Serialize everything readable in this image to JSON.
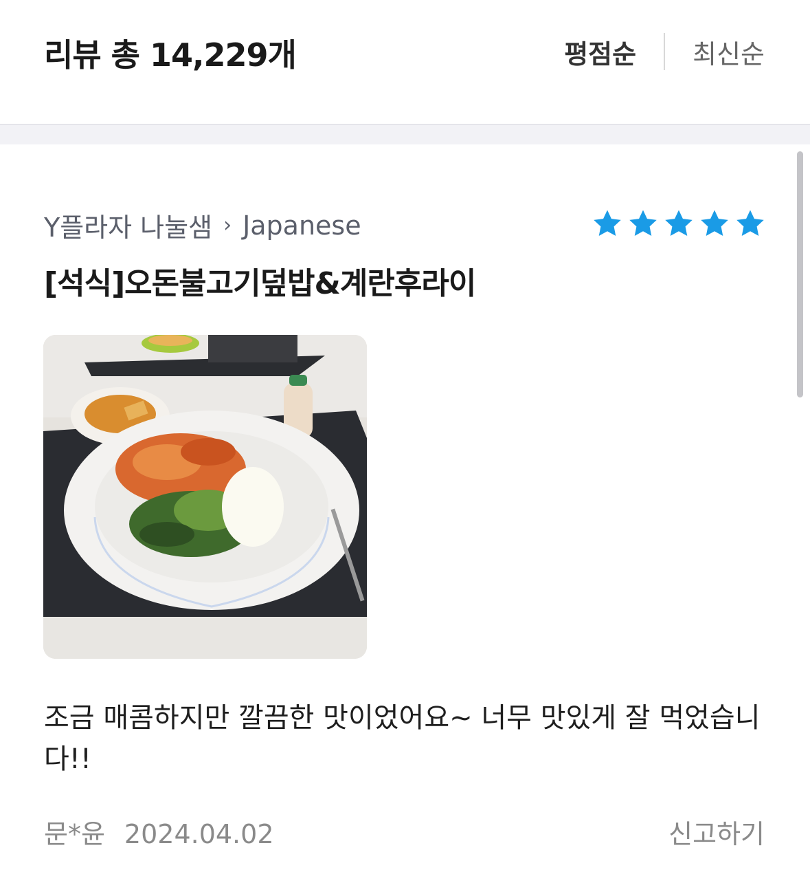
{
  "header": {
    "title": "리뷰 총 14,229개",
    "sort_options": [
      "평점순",
      "최신순"
    ],
    "active_sort": "평점순"
  },
  "review": {
    "restaurant": "Y플라자 나눌샘",
    "category": "Japanese",
    "rating": 5,
    "rating_max": 5,
    "star_color": "#1a9be6",
    "menu": "[석식]오돈불고기덮밥&계란후라이",
    "photo_icon": "food-photo",
    "text": "조금 매콤하지만 깔끔한 맛이었어요~ 너무 맛있게 잘 먹었습니다!!",
    "author": "문*윤",
    "date": "2024.04.02",
    "report_label": "신고하기"
  }
}
